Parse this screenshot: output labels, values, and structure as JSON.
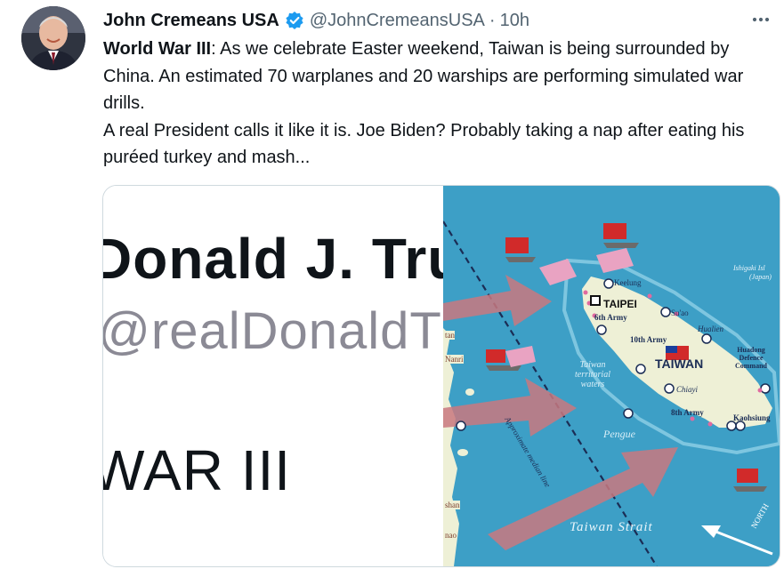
{
  "author": {
    "name": "John Cremeans USA",
    "handle": "@JohnCremeansUSA",
    "separator": "·",
    "time": "10h"
  },
  "tweet": {
    "bold_prefix": "World War III",
    "line1": ": As we celebrate Easter weekend, Taiwan is being surrounded by China. An estimated 70 warplanes and 20 warships are performing simulated war drills.",
    "line2": "A real President calls it like it is. Joe Biden? Probably taking a nap after eating his puréed turkey and mash..."
  },
  "more_icon": "more-horizontal-icon",
  "colors": {
    "verified_blue": "#1d9bf0",
    "sea": "#3d9fc6",
    "land": "#eef0d6",
    "arrow": "#c9787f"
  },
  "media": {
    "left_image": {
      "line1": "Donald J. Tru",
      "line2": "@realDonaldTr",
      "line3": "WAR III"
    },
    "right_image": {
      "labels": {
        "taipei": "TAIPEI",
        "keelung": "Keelung",
        "suao": "Su'ao",
        "army6": "6th Army",
        "army10": "10th Army",
        "army8": "8th Army",
        "taiwan": "TAIWAN",
        "hualien": "Hualien",
        "huadong": "Huadong Defence Command",
        "chiayi": "Chiayi",
        "kaohsiung": "Kaohsiung",
        "pengue": "Pengue",
        "territorial": "Taiwan territorial waters",
        "median": "Approximate median line",
        "strait": "Taiwan Strait",
        "ishigaki": "Ishigaki Isl",
        "japan": "(Japan)",
        "north": "NORTH",
        "tan": "tan",
        "nanri": "Nanri",
        "shan": "shan",
        "nao": "nao"
      }
    }
  }
}
